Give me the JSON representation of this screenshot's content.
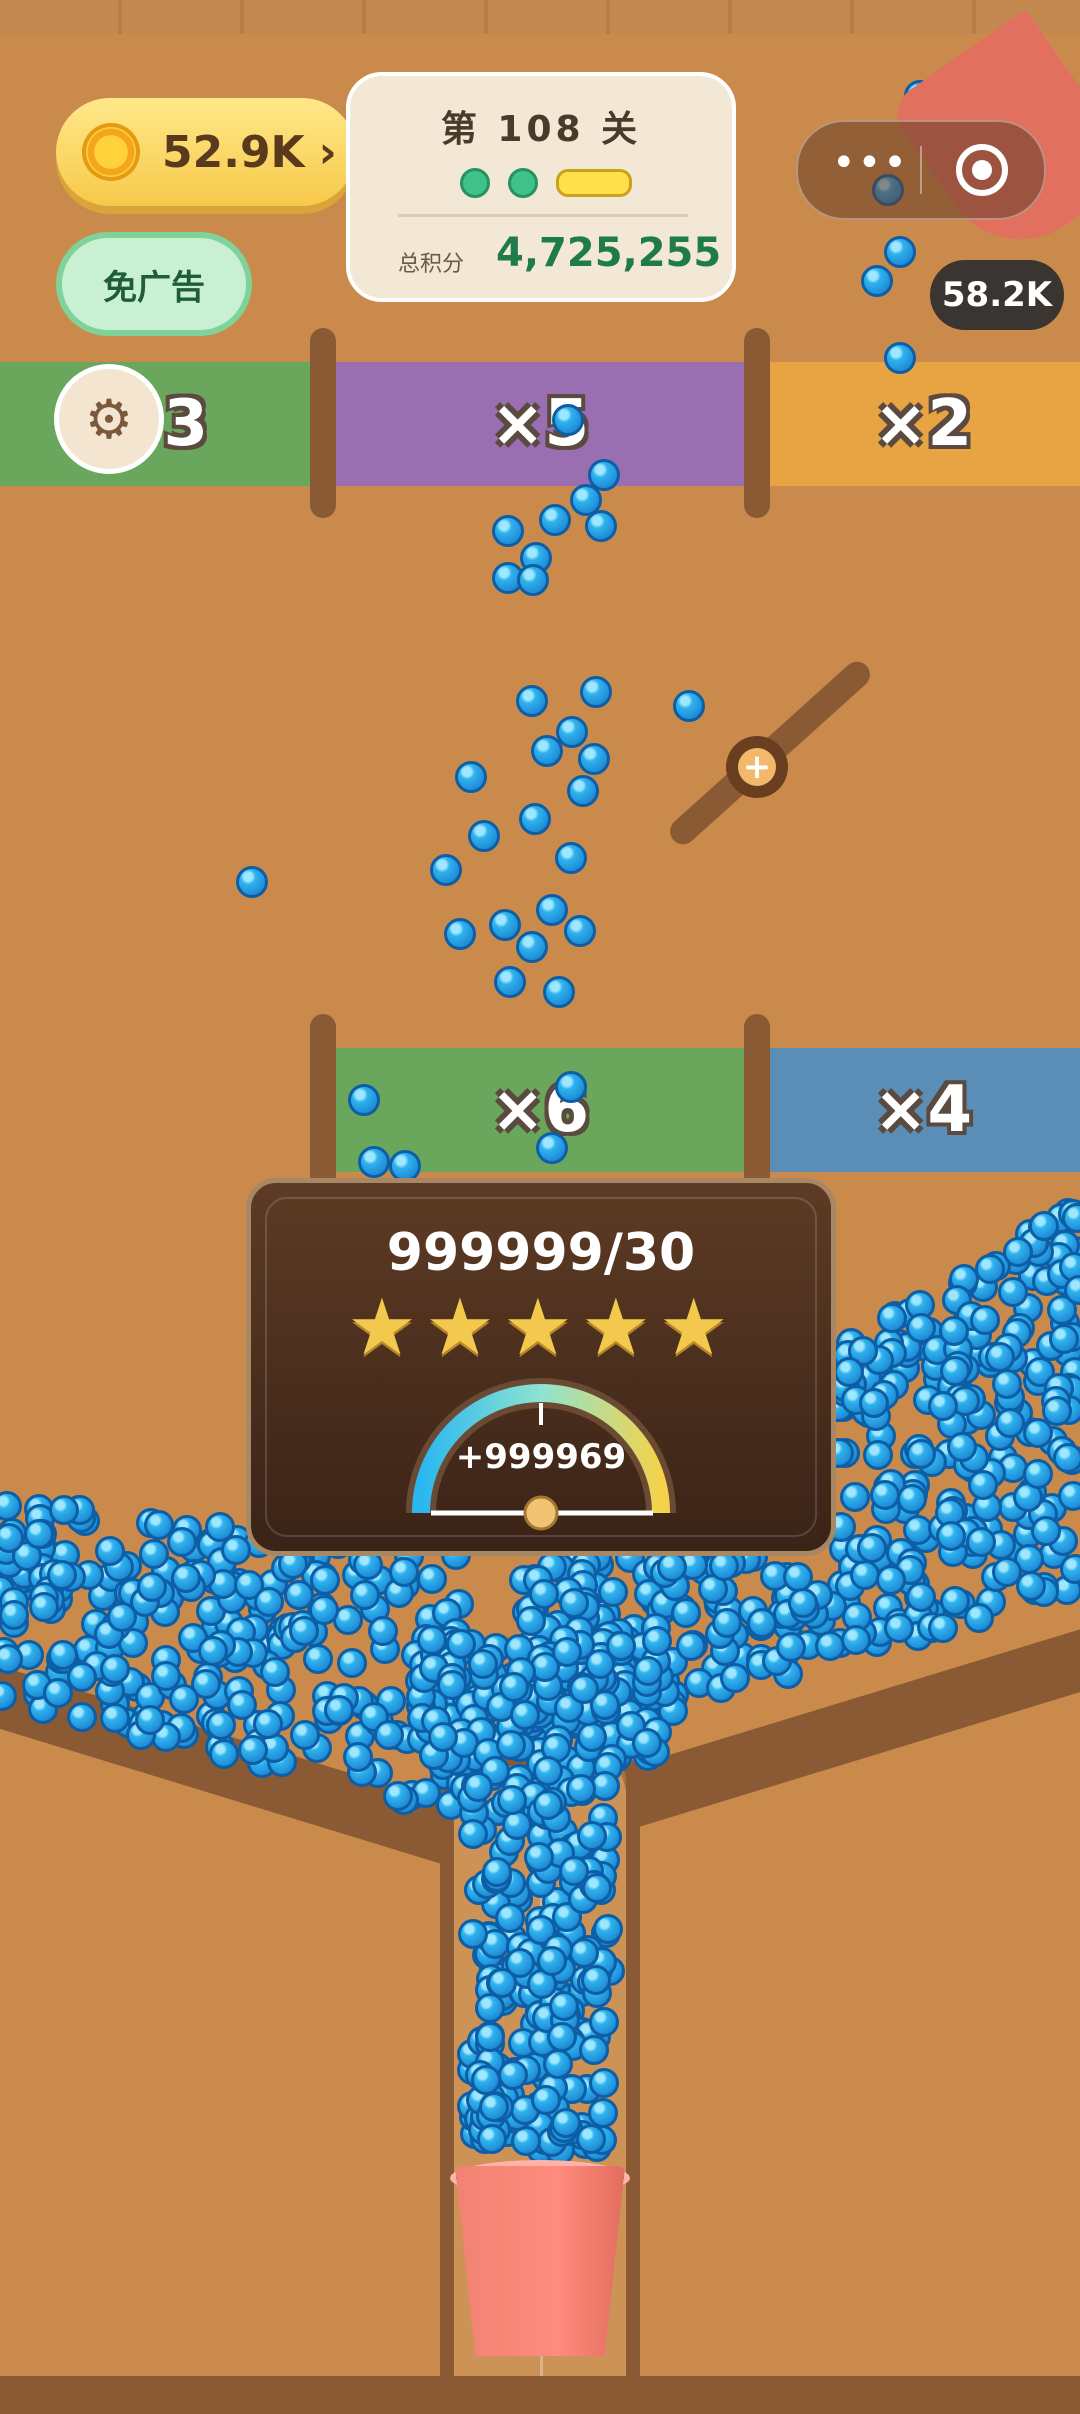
{
  "hud": {
    "coins": "52.9K",
    "coin_arrow": "›",
    "no_ads_label": "免广告",
    "level_title": "第 108 关",
    "total_score_label": "总积分",
    "total_score": "4,725,255",
    "ball_count": "58.2K",
    "capsule_menu": "•••"
  },
  "multipliers": {
    "top": [
      "×3",
      "×5",
      "×2"
    ],
    "bottom": [
      "×6",
      "×4"
    ]
  },
  "paddle": {
    "pivot_symbol": "+"
  },
  "result": {
    "score": "999999/30",
    "stars": 5,
    "star_symbol": "★",
    "bonus": "+999969"
  },
  "colors": {
    "ball_blue": "#2fb2ee",
    "band_green": "#6aa65c",
    "band_purple": "#9a6fb1",
    "band_orange": "#e8a342",
    "band_blue": "#5b8eb7",
    "score_green": "#1f7a4c"
  },
  "icons": [
    "coin-icon",
    "settings-gear-icon",
    "wechat-menu-icon",
    "wechat-close-icon",
    "star-icon"
  ]
}
